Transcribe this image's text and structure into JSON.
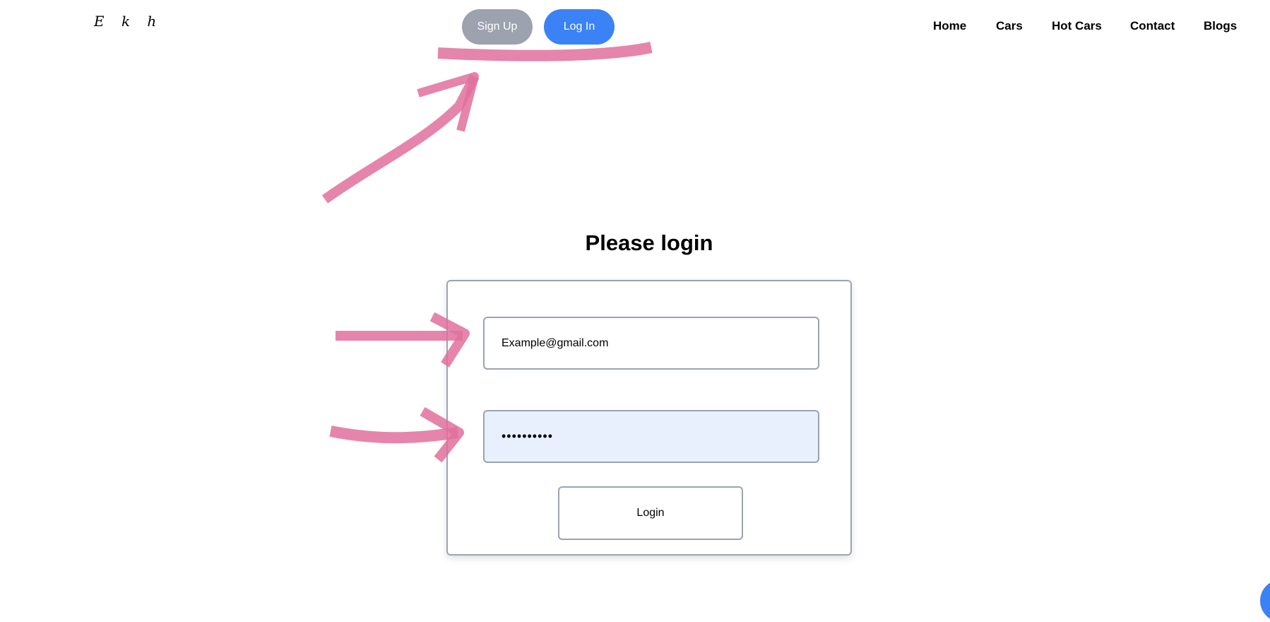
{
  "header": {
    "logo_text": "E k h",
    "signup_label": "Sign Up",
    "login_label": "Log In",
    "nav": {
      "home": "Home",
      "cars": "Cars",
      "hot_cars": "Hot Cars",
      "contact": "Contact",
      "blogs": "Blogs"
    }
  },
  "login": {
    "title": "Please login",
    "email_value": "Example@gmail.com",
    "password_value": "••••••••••",
    "submit_label": "Login"
  },
  "colors": {
    "signup_bg": "#9ca3af",
    "login_bg": "#3b82f6",
    "password_field_bg": "#e8f0fe",
    "border": "#9ca3af",
    "annotation": "#e0709c"
  }
}
